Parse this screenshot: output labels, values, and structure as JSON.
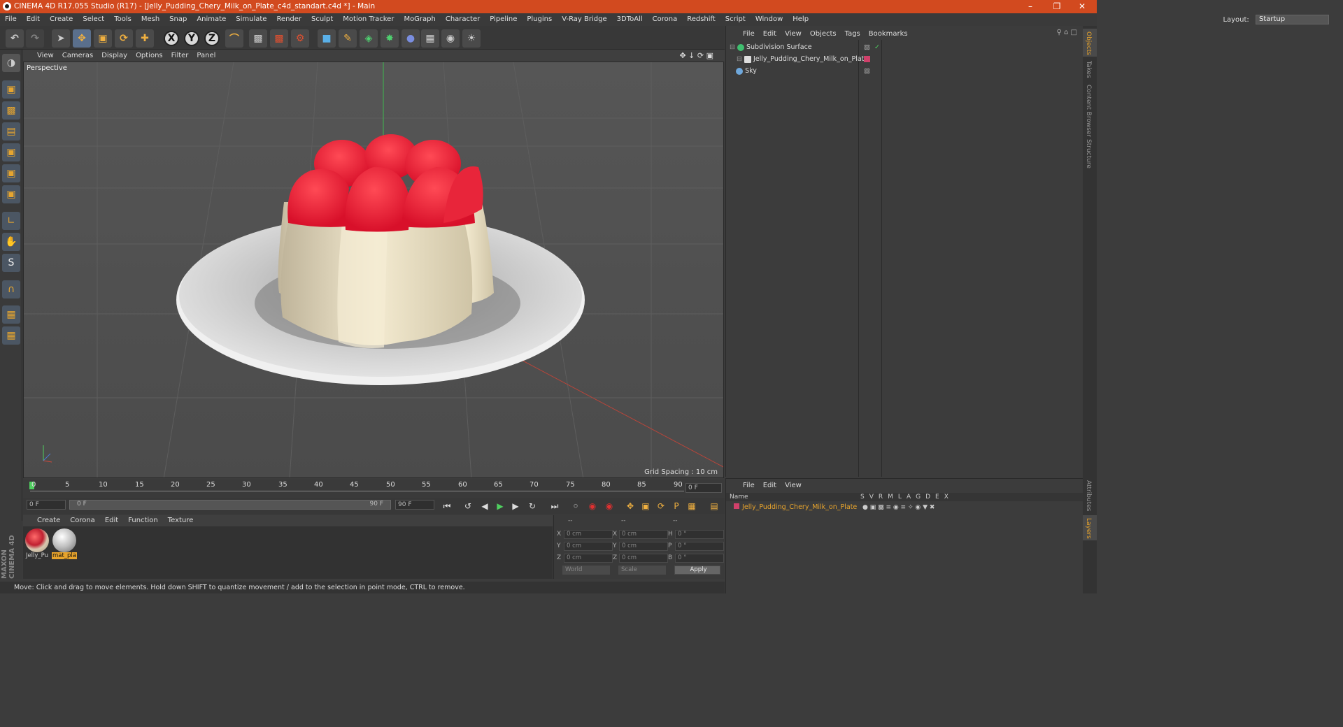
{
  "window": {
    "title": "CINEMA 4D R17.055 Studio (R17) - [Jelly_Pudding_Chery_Milk_on_Plate_c4d_standart.c4d *] - Main"
  },
  "menu": [
    "File",
    "Edit",
    "Create",
    "Select",
    "Tools",
    "Mesh",
    "Snap",
    "Animate",
    "Simulate",
    "Render",
    "Sculpt",
    "Motion Tracker",
    "MoGraph",
    "Character",
    "Pipeline",
    "Plugins",
    "V-Ray Bridge",
    "3DToAll",
    "Corona",
    "Redshift",
    "Script",
    "Window",
    "Help"
  ],
  "layout": {
    "label": "Layout:",
    "value": "Startup"
  },
  "viewport": {
    "menu": [
      "View",
      "Cameras",
      "Display",
      "Options",
      "Filter",
      "Panel"
    ],
    "label": "Perspective",
    "grid_spacing": "Grid Spacing : 10 cm"
  },
  "timeline": {
    "ticks": [
      "0",
      "5",
      "10",
      "15",
      "20",
      "25",
      "30",
      "35",
      "40",
      "45",
      "50",
      "55",
      "60",
      "65",
      "70",
      "75",
      "80",
      "85",
      "90"
    ],
    "current_frame": "0 F",
    "start": "0 F",
    "range_start": "0 F",
    "range_end": "90 F",
    "end": "90 F"
  },
  "materials": {
    "menu": [
      "Create",
      "Corona",
      "Edit",
      "Function",
      "Texture"
    ],
    "items": [
      {
        "label": "Jelly_Pu",
        "color": "#d94a4a"
      },
      {
        "label": "mat_pla",
        "color": "#cfcfcf"
      }
    ]
  },
  "coords": {
    "header": [
      "--",
      "--",
      "--"
    ],
    "rows": [
      {
        "a": "X",
        "av": "0 cm",
        "b": "X",
        "bv": "0 cm",
        "c": "H",
        "cv": "0 °"
      },
      {
        "a": "Y",
        "av": "0 cm",
        "b": "Y",
        "bv": "0 cm",
        "c": "P",
        "cv": "0 °"
      },
      {
        "a": "Z",
        "av": "0 cm",
        "b": "Z",
        "bv": "0 cm",
        "c": "B",
        "cv": "0 °"
      }
    ],
    "world": "World",
    "scale": "Scale",
    "apply": "Apply"
  },
  "status": "Move: Click and drag to move elements. Hold down SHIFT to quantize movement / add to the selection in point mode, CTRL to remove.",
  "objects": {
    "menu": [
      "File",
      "Edit",
      "View",
      "Objects",
      "Tags",
      "Bookmarks"
    ],
    "items": [
      {
        "name": "Subdivision Surface",
        "icon_color": "#3fbf6f"
      },
      {
        "name": "Jelly_Pudding_Chery_Milk_on_Plate",
        "icon_color": "#dddddd"
      },
      {
        "name": "Sky",
        "icon_color": "#6fa8dc"
      }
    ]
  },
  "layers": {
    "menu": [
      "File",
      "Edit",
      "View"
    ],
    "header": {
      "name": "Name",
      "cols": [
        "S",
        "V",
        "R",
        "M",
        "L",
        "A",
        "G",
        "D",
        "E",
        "X"
      ]
    },
    "items": [
      {
        "name": "Jelly_Pudding_Chery_Milk_on_Plate",
        "color": "#e8a42c"
      }
    ]
  },
  "side_tabs": [
    "Objects",
    "Takes",
    "Content Browser",
    "Structure",
    "Attributes",
    "Layers"
  ],
  "brand": {
    "text": "MAXON CINEMA 4D"
  }
}
